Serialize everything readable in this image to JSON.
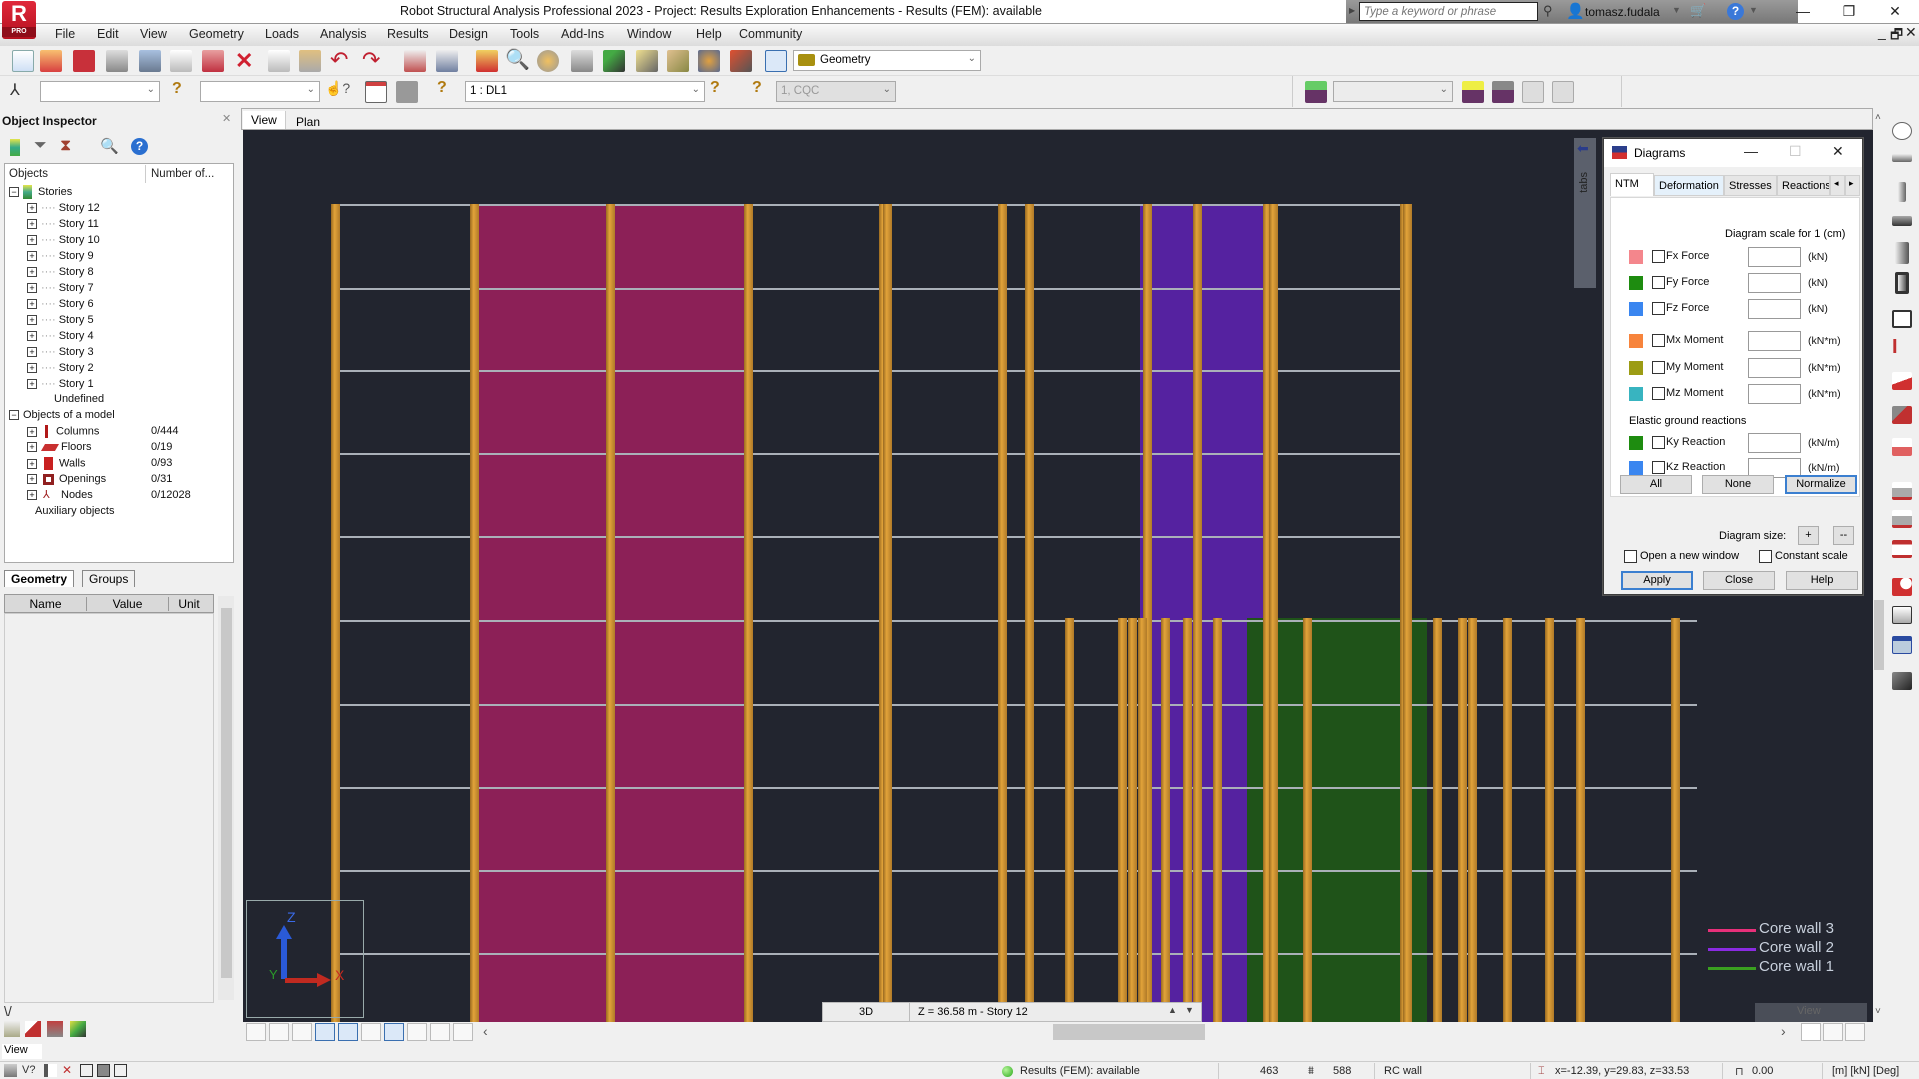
{
  "app": {
    "title": "Robot Structural Analysis Professional 2023 - Project: Results Exploration Enhancements - Results (FEM): available",
    "logo_letter": "R",
    "logo_badge": "PRO",
    "search_placeholder": "Type a keyword or phrase",
    "username": "tomasz.fudala",
    "window_buttons": {
      "minimize": "—",
      "restore": "❐",
      "close": "✕"
    },
    "mdi_buttons": {
      "minimize": "_",
      "restore": "🗗",
      "close": "✕"
    }
  },
  "menu": [
    "File",
    "Edit",
    "View",
    "Geometry",
    "Loads",
    "Analysis",
    "Results",
    "Design",
    "Tools",
    "Add-Ins",
    "Window",
    "Help",
    "Community"
  ],
  "toolbar1": {
    "layout_combo": "Geometry",
    "icons": [
      "new-file",
      "open-folder",
      "save",
      "print",
      "book",
      "preview",
      "screen-capture",
      "delete",
      "copy",
      "paste",
      "undo",
      "redo",
      "calculator",
      "calculator-table",
      "lock",
      "zoom",
      "zoom-pan",
      "section-view",
      "node-tool",
      "measure",
      "angle",
      "settings-gear",
      "wrench",
      "layout-manager"
    ]
  },
  "toolbar2": {
    "combo1_value": "",
    "combo2_value": "",
    "load_case": "1 : DL1",
    "mode_combo": "1, CQC",
    "right_combo_value": ""
  },
  "object_inspector": {
    "title": "Object Inspector",
    "col_objects": "Objects",
    "col_number": "Number of...",
    "stories_label": "Stories",
    "stories": [
      "Story 12",
      "Story 11",
      "Story 10",
      "Story 9",
      "Story 8",
      "Story 7",
      "Story 6",
      "Story 5",
      "Story 4",
      "Story 3",
      "Story 2",
      "Story 1"
    ],
    "undefined_label": "Undefined",
    "model_label": "Objects of a model",
    "model_objects": [
      {
        "name": "Columns",
        "count": "0/444",
        "icon": "column-icon"
      },
      {
        "name": "Floors",
        "count": "0/19",
        "icon": "floor-icon"
      },
      {
        "name": "Walls",
        "count": "0/93",
        "icon": "wall-icon"
      },
      {
        "name": "Openings",
        "count": "0/31",
        "icon": "opening-icon"
      },
      {
        "name": "Nodes",
        "count": "0/12028",
        "icon": "node-icon"
      }
    ],
    "auxiliary_label": "Auxiliary objects",
    "tabs": [
      "Geometry",
      "Groups"
    ],
    "prop_headers": [
      "Name",
      "Value",
      "Unit"
    ]
  },
  "viewport": {
    "tabs": [
      "View",
      "Plan"
    ],
    "strip_label": "tabs",
    "view_mode": "3D",
    "story_info": "Z = 36.58 m - Story 12",
    "axis_labels": {
      "x": "X",
      "y": "Y",
      "z": "Z"
    },
    "legend": [
      {
        "label": "Core wall 3",
        "color": "#e8307a"
      },
      {
        "label": "Core wall 2",
        "color": "#8a2be2"
      },
      {
        "label": "Core wall 1",
        "color": "#3aa020"
      }
    ],
    "wall_colors": {
      "core3": "#8c2057",
      "core2": "#5522a0",
      "core1": "#1f5319"
    },
    "ghost_label": "View"
  },
  "diagrams": {
    "title": "Diagrams",
    "tabs": [
      "NTM",
      "Deformation",
      "Stresses",
      "Reactions"
    ],
    "active_tab": "NTM",
    "scale_header": "Diagram scale for 1  (cm)",
    "rows": [
      {
        "label": "Fx Force",
        "unit": "(kN)",
        "color": "#f4868c",
        "checked": false,
        "value": ""
      },
      {
        "label": "Fy Force",
        "unit": "(kN)",
        "color": "#1e8c10",
        "checked": false,
        "value": ""
      },
      {
        "label": "Fz Force",
        "unit": "(kN)",
        "color": "#3a86f0",
        "checked": false,
        "value": ""
      },
      {
        "label": "Mx Moment",
        "unit": "(kN*m)",
        "color": "#f7843c",
        "checked": false,
        "value": ""
      },
      {
        "label": "My Moment",
        "unit": "(kN*m)",
        "color": "#9c9c14",
        "checked": false,
        "value": ""
      },
      {
        "label": "Mz Moment",
        "unit": "(kN*m)",
        "color": "#38b4c0",
        "checked": false,
        "value": ""
      }
    ],
    "elastic_header": "Elastic ground reactions",
    "elastic_rows": [
      {
        "label": "Ky Reaction",
        "unit": "(kN/m)",
        "color": "#1e8c10",
        "checked": false,
        "value": ""
      },
      {
        "label": "Kz Reaction",
        "unit": "(kN/m)",
        "color": "#3a86f0",
        "checked": false,
        "value": ""
      }
    ],
    "btn_all": "All",
    "btn_none": "None",
    "btn_normalize": "Normalize",
    "diagram_size_label": "Diagram size:",
    "btn_plus": "+",
    "btn_minus": "--",
    "open_new_window": "Open a new window",
    "constant_scale": "Constant scale",
    "btn_apply": "Apply",
    "btn_close": "Close",
    "btn_help": "Help"
  },
  "statusbar": {
    "view_field": "View",
    "results": "Results (FEM): available",
    "num1": "463",
    "num2": "588",
    "object_type": "RC wall",
    "coords": "x=-12.39, y=29.83, z=33.53",
    "angle": "0.00",
    "units": "[m] [kN] [Deg]"
  }
}
